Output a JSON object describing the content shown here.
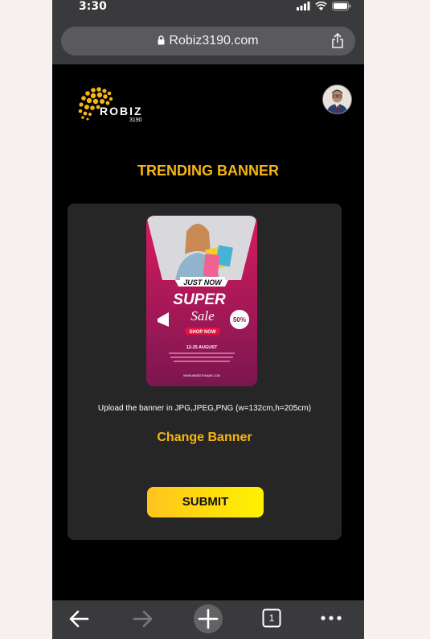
{
  "status": {
    "time": "3:30"
  },
  "browser": {
    "url": "Robiz3190.com",
    "tab_count": "1"
  },
  "brand": {
    "name": "ROBIZ",
    "sub": "3190"
  },
  "page": {
    "title": "TRENDING BANNER",
    "instructions": "Upload the banner in JPG,JPEG,PNG (w=132cm,h=205cm)",
    "change_banner": "Change Banner",
    "submit": "SUBMIT"
  },
  "banner": {
    "just_now": "JUST NOW",
    "super": "SUPER",
    "sale": "Sale",
    "discount": "50%",
    "shop_now": "SHOP NOW",
    "date": "12-25 AUGUST",
    "website": "WWW.WEBSITENAME.COM"
  },
  "colors": {
    "accent": "#f7b712",
    "card": "#262626",
    "background": "#000000"
  }
}
